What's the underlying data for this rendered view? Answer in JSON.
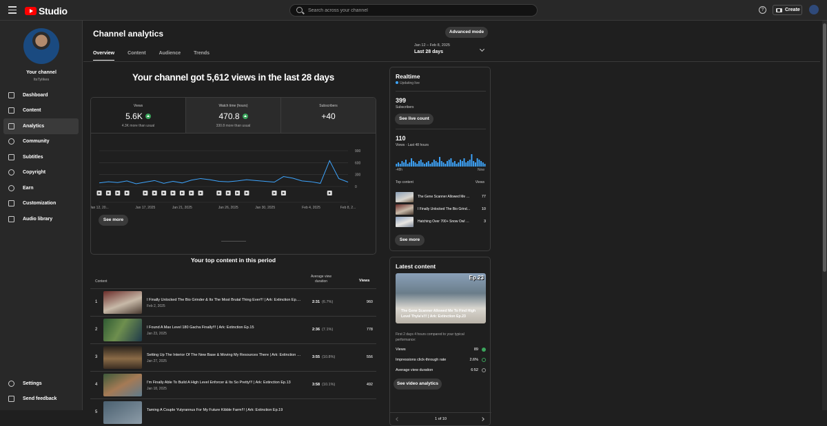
{
  "app": {
    "logo_text": "Studio",
    "brand_color": "#ff0000"
  },
  "search": {
    "placeholder": "Search across your channel"
  },
  "header": {
    "create_label": "Create"
  },
  "channel": {
    "name": "Your channel",
    "handle": "ItsTylikes"
  },
  "sidebar": {
    "items": [
      {
        "label": "Dashboard",
        "icon": "dashboard-icon"
      },
      {
        "label": "Content",
        "icon": "content-icon"
      },
      {
        "label": "Analytics",
        "icon": "analytics-icon",
        "active": true
      },
      {
        "label": "Community",
        "icon": "community-icon"
      },
      {
        "label": "Subtitles",
        "icon": "subtitles-icon"
      },
      {
        "label": "Copyright",
        "icon": "copyright-icon"
      },
      {
        "label": "Earn",
        "icon": "earn-icon"
      },
      {
        "label": "Customization",
        "icon": "customization-icon"
      },
      {
        "label": "Audio library",
        "icon": "audio-library-icon"
      }
    ],
    "bottom": [
      {
        "label": "Settings",
        "icon": "settings-icon"
      },
      {
        "label": "Send feedback",
        "icon": "feedback-icon"
      }
    ]
  },
  "page": {
    "title": "Channel analytics",
    "advanced_mode": "Advanced mode",
    "tabs": [
      "Overview",
      "Content",
      "Audience",
      "Trends"
    ],
    "date_range": {
      "dates": "Jan 12 – Feb 8, 2025",
      "label": "Last 28 days"
    }
  },
  "overview": {
    "headline": "Your channel got 5,612 views in the last 28 days",
    "metrics": [
      {
        "label": "Views",
        "value": "5.6K",
        "note": "4.3K more than usual"
      },
      {
        "label": "Watch time (hours)",
        "value": "470.8",
        "note": "330.8 more than usual"
      },
      {
        "label": "Subscribers",
        "value": "+40",
        "note": ""
      }
    ],
    "see_more": "See more"
  },
  "chart_data": {
    "type": "line",
    "title": "",
    "xlabel": "",
    "ylabel": "",
    "x": [
      "Jan 12",
      "Jan 13",
      "Jan 14",
      "Jan 15",
      "Jan 16",
      "Jan 17",
      "Jan 18",
      "Jan 19",
      "Jan 20",
      "Jan 21",
      "Jan 22",
      "Jan 23",
      "Jan 24",
      "Jan 25",
      "Jan 26",
      "Jan 27",
      "Jan 28",
      "Jan 29",
      "Jan 30",
      "Jan 31",
      "Feb 1",
      "Feb 2",
      "Feb 3",
      "Feb 4",
      "Feb 5",
      "Feb 6",
      "Feb 7",
      "Feb 8"
    ],
    "series": [
      {
        "values": [
          90,
          120,
          100,
          140,
          70,
          110,
          150,
          80,
          130,
          90,
          160,
          200,
          170,
          130,
          120,
          140,
          170,
          150,
          130,
          110,
          250,
          210,
          140,
          120,
          80,
          650,
          200,
          110
        ]
      }
    ],
    "y_ticks": [
      "900",
      "600",
      "300",
      "0"
    ],
    "ylim": [
      0,
      900
    ],
    "x_tick_labels": [
      "Jan 12, 20...",
      "Jan 17, 2025",
      "Jan 21, 2025",
      "Jan 26, 2025",
      "Jan 30, 2025",
      "Feb 4, 2025",
      "Feb 8, 2..."
    ],
    "grid": true,
    "line_color": "#3ea6ff"
  },
  "top_content": {
    "title": "Your top content in this period",
    "headers": {
      "content": "Content",
      "avd": "Average view duration",
      "views": "Views"
    },
    "rows": [
      {
        "rank": "1",
        "title": "I Finally Unlocked The Bio Grinder & Its The Most Brutal Thing Ever!!! | Ark: Extinction Ep.25",
        "date": "Feb 2, 2025",
        "avd": "2:31",
        "pct": "(6.7%)",
        "views": "960"
      },
      {
        "rank": "2",
        "title": "I Found A Max Level 180 Gacha Finally!!! | Ark: Extinction Ep.15",
        "date": "Jan 23, 2025",
        "avd": "2:36",
        "pct": "(7.1%)",
        "views": "778"
      },
      {
        "rank": "3",
        "title": "Setting Up The Interior Of The New Base & Moving My Resources There | Ark: Extinction Ep.17",
        "date": "Jan 27, 2025",
        "avd": "3:55",
        "pct": "(10.8%)",
        "views": "556"
      },
      {
        "rank": "4",
        "title": "I'm Finally Able To Build A High Level Enforcer & Its So Pretty!!! | Ark: Extinction Ep.13",
        "date": "Jan 18, 2025",
        "avd": "3:58",
        "pct": "(10.1%)",
        "views": "492"
      },
      {
        "rank": "5",
        "title": "Taming A Couple Yutyrannus For My Future Kibble Farm!!! | Ark: Extinction Ep.19",
        "date": "",
        "avd": "",
        "pct": "",
        "views": ""
      }
    ]
  },
  "realtime": {
    "title": "Realtime",
    "live": "Updating live",
    "subscribers": {
      "value": "399",
      "label": "Subscribers"
    },
    "see_live_count": "See live count",
    "views": {
      "value": "110",
      "label": "Views · Last 48 hours"
    },
    "axis": {
      "start": "-48h",
      "end": "Now"
    },
    "bars": [
      2,
      3,
      2,
      4,
      3,
      5,
      2,
      3,
      6,
      4,
      3,
      2,
      4,
      5,
      3,
      2,
      3,
      4,
      2,
      3,
      5,
      4,
      3,
      7,
      4,
      3,
      2,
      4,
      5,
      6,
      3,
      4,
      2,
      3,
      5,
      4,
      6,
      3,
      4,
      5,
      9,
      4,
      3,
      6,
      5,
      4,
      3,
      2
    ],
    "top_content_label": "Top content",
    "views_label": "Views",
    "items": [
      {
        "title": "The Gene Scanner Allowed Me To Find High Level Thyla's!!! | Ark: Extinction Ep.23",
        "views": "77"
      },
      {
        "title": "I Finally Unlocked The Bio Grinder & Its The Most Brutal Thing Ever!!!",
        "views": "10"
      },
      {
        "title": "Hatching Over 700+ Snow Owl Eggs",
        "views": "3"
      }
    ],
    "see_more": "See more"
  },
  "latest": {
    "title": "Latest content",
    "episode": "Ep.23",
    "video_title": "The Gene Scanner Allowed Me To Find High Level Thyla's!!! | Ark: Extinction Ep.23",
    "note": "First 2 days 4 hours compared to your typical performance:",
    "metrics": [
      {
        "label": "Views",
        "value": "89",
        "status_color": "#3ba55c"
      },
      {
        "label": "Impressions click-through rate",
        "value": "2.6%",
        "status_color": "#3ba55c"
      },
      {
        "label": "Average view duration",
        "value": "6:52",
        "status_color": "#9a9a9a"
      }
    ],
    "button": "See video analytics",
    "pager": "1 of 10"
  }
}
